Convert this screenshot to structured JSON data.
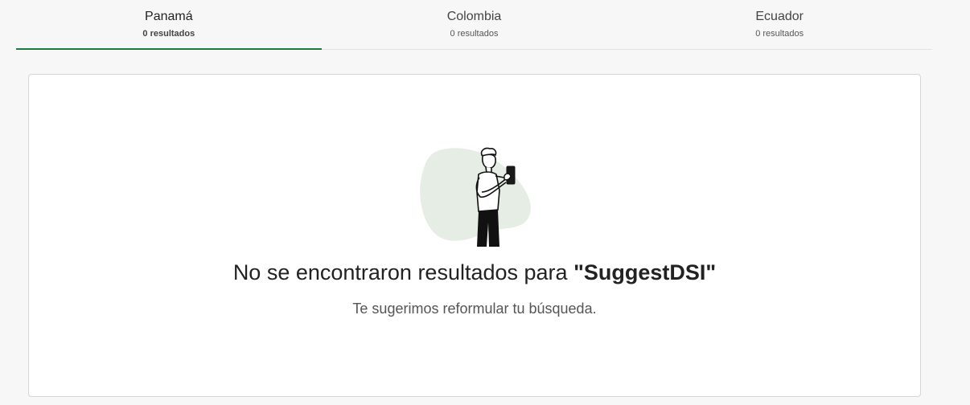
{
  "tabs": [
    {
      "name": "Panamá",
      "count": "0 resultados",
      "active": true
    },
    {
      "name": "Colombia",
      "count": "0 resultados",
      "active": false
    },
    {
      "name": "Ecuador",
      "count": "0 resultados",
      "active": false
    }
  ],
  "empty_state": {
    "title_prefix": "No se encontraron resultados para ",
    "query": "\"SuggestDSI\"",
    "subtitle": "Te sugerimos reformular tu búsqueda.",
    "illustration": "person-holding-phone-illustration"
  },
  "colors": {
    "accent": "#1f7a3f",
    "illustration_blob": "#e5ede5"
  }
}
